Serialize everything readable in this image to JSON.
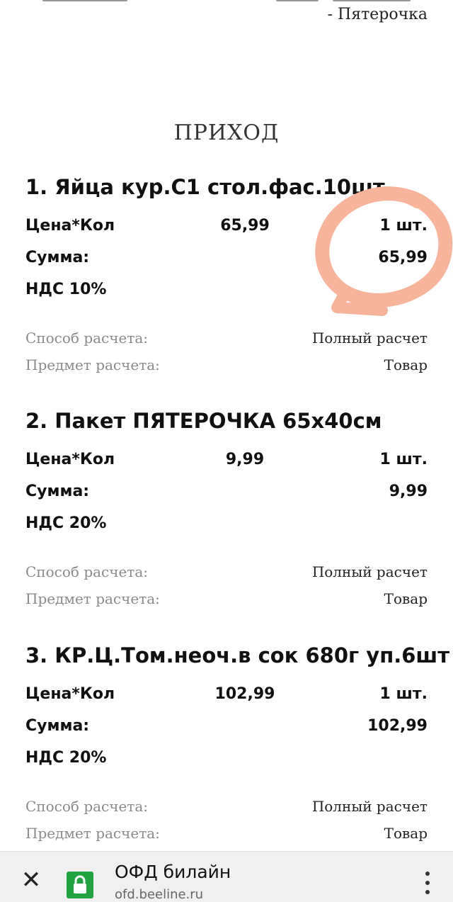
{
  "header": {
    "store": "- Пятерочка",
    "receipt_type": "ПРИХОД"
  },
  "items": [
    {
      "title": "1. Яйца кур.С1 стол.фас.10шт",
      "price_label": "Цена*Кол",
      "price": "65,99",
      "qty": "1 шт.",
      "sum_label": "Сумма:",
      "sum": "65,99",
      "vat": "НДС 10%",
      "method_label": "Способ расчета:",
      "method": "Полный расчет",
      "subject_label": "Предмет расчета:",
      "subject": "Товар"
    },
    {
      "title": "2. Пакет ПЯТЕРОЧКА 65x40см",
      "price_label": "Цена*Кол",
      "price": "9,99",
      "qty": "1 шт.",
      "sum_label": "Сумма:",
      "sum": "9,99",
      "vat": "НДС 20%",
      "method_label": "Способ расчета:",
      "method": "Полный расчет",
      "subject_label": "Предмет расчета:",
      "subject": "Товар"
    },
    {
      "title": "3. КР.Ц.Том.неоч.в сок 680г уп.6шт",
      "price_label": "Цена*Кол",
      "price": "102,99",
      "qty": "1 шт.",
      "sum_label": "Сумма:",
      "sum": "102,99",
      "vat": "НДС 20%",
      "method_label": "Способ расчета:",
      "method": "Полный расчет",
      "subject_label": "Предмет расчета:",
      "subject": "Товар"
    }
  ],
  "browser_bar": {
    "site_name": "ОФД билайн",
    "site_url": "ofd.beeline.ru",
    "close_icon": "close-icon",
    "lock_icon": "lock-icon",
    "menu_icon": "more-vertical-icon",
    "lock_color": "#21a340"
  },
  "annotation": {
    "color": "#f8b49a"
  }
}
